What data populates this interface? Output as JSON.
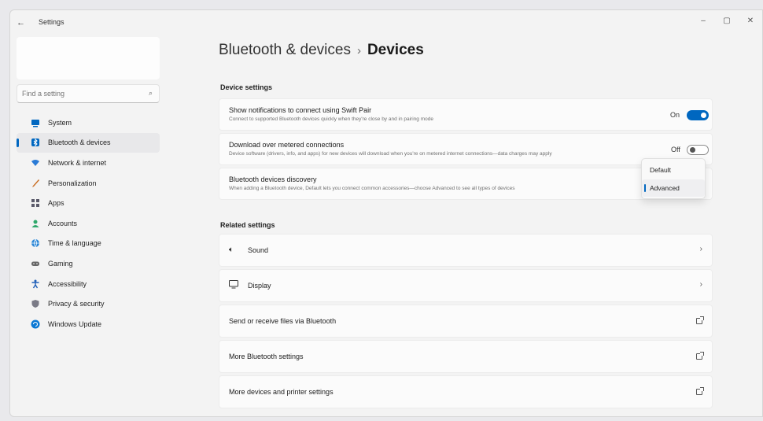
{
  "titlebar": {
    "back": "←",
    "title": "Settings",
    "minimize": "–",
    "restore": "▢",
    "close": "✕"
  },
  "search": {
    "placeholder": "Find a setting"
  },
  "sidebar": {
    "items": [
      {
        "label": "System",
        "icon": "system-icon",
        "color": "#0067c0"
      },
      {
        "label": "Bluetooth & devices",
        "icon": "bluetooth-icon",
        "color": "#0067c0",
        "active": true
      },
      {
        "label": "Network & internet",
        "icon": "network-icon",
        "color": "#2a7bd6"
      },
      {
        "label": "Personalization",
        "icon": "brush-icon",
        "color": "#c86b1f"
      },
      {
        "label": "Apps",
        "icon": "apps-icon",
        "color": "#5a5a6a"
      },
      {
        "label": "Accounts",
        "icon": "person-icon",
        "color": "#2fa86b"
      },
      {
        "label": "Time & language",
        "icon": "globe-icon",
        "color": "#2a86d6"
      },
      {
        "label": "Gaming",
        "icon": "gamepad-icon",
        "color": "#666"
      },
      {
        "label": "Accessibility",
        "icon": "accessibility-icon",
        "color": "#1f5fb8"
      },
      {
        "label": "Privacy & security",
        "icon": "shield-icon",
        "color": "#7a7a86"
      },
      {
        "label": "Windows Update",
        "icon": "update-icon",
        "color": "#0a78d4"
      }
    ]
  },
  "breadcrumb": {
    "parent": "Bluetooth & devices",
    "separator": "›",
    "current": "Devices"
  },
  "device_settings": {
    "heading": "Device settings",
    "swift_pair": {
      "title": "Show notifications to connect using Swift Pair",
      "desc": "Connect to supported Bluetooth devices quickly when they're close by and in pairing mode",
      "state": "On"
    },
    "metered": {
      "title": "Download over metered connections",
      "desc": "Device software (drivers, info, and apps) for new devices will download when you're on metered internet connections—data charges may apply",
      "state": "Off"
    },
    "discovery": {
      "title": "Bluetooth devices discovery",
      "desc": "When adding a Bluetooth device, Default lets you connect common accessories—choose Advanced to see all types of devices",
      "options": [
        "Default",
        "Advanced"
      ],
      "selected": "Advanced"
    }
  },
  "related_settings": {
    "heading": "Related settings",
    "items": [
      {
        "label": "Sound",
        "icon": "speaker-icon",
        "trail": "›"
      },
      {
        "label": "Display",
        "icon": "monitor-icon",
        "trail": "›"
      },
      {
        "label": "Send or receive files via Bluetooth",
        "icon": "",
        "trail": "external"
      },
      {
        "label": "More Bluetooth settings",
        "icon": "",
        "trail": "external"
      },
      {
        "label": "More devices and printer settings",
        "icon": "",
        "trail": "external"
      }
    ]
  },
  "colors": {
    "accent": "#0067c0",
    "background": "#f3f3f3",
    "card": "#fbfbfb"
  }
}
